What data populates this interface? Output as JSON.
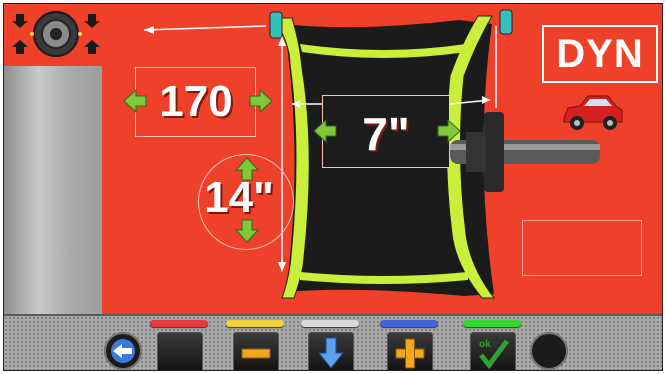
{
  "measurements": {
    "width_value": "170",
    "diameter_value": "14\"",
    "offset_value": "7\""
  },
  "mode": {
    "label": "DYN"
  },
  "colors": {
    "screen_background": "#ef4029",
    "rim_green": "#c9ef3a",
    "bar_red": "#e63a3a",
    "bar_yellow": "#f0d23a",
    "bar_white": "#d9d9d9",
    "bar_blue": "#3f63d9",
    "bar_green": "#34d934",
    "ok_text": "#2fa32f"
  },
  "toolbar": {
    "ok_label": "ok"
  },
  "icons": {
    "back": "back-arrow-icon",
    "minus": "minus-icon",
    "down": "down-arrow-icon",
    "plus": "plus-icon",
    "ok": "ok-check-icon",
    "car": "car-icon",
    "mode": "balancer-wheel-icon"
  }
}
